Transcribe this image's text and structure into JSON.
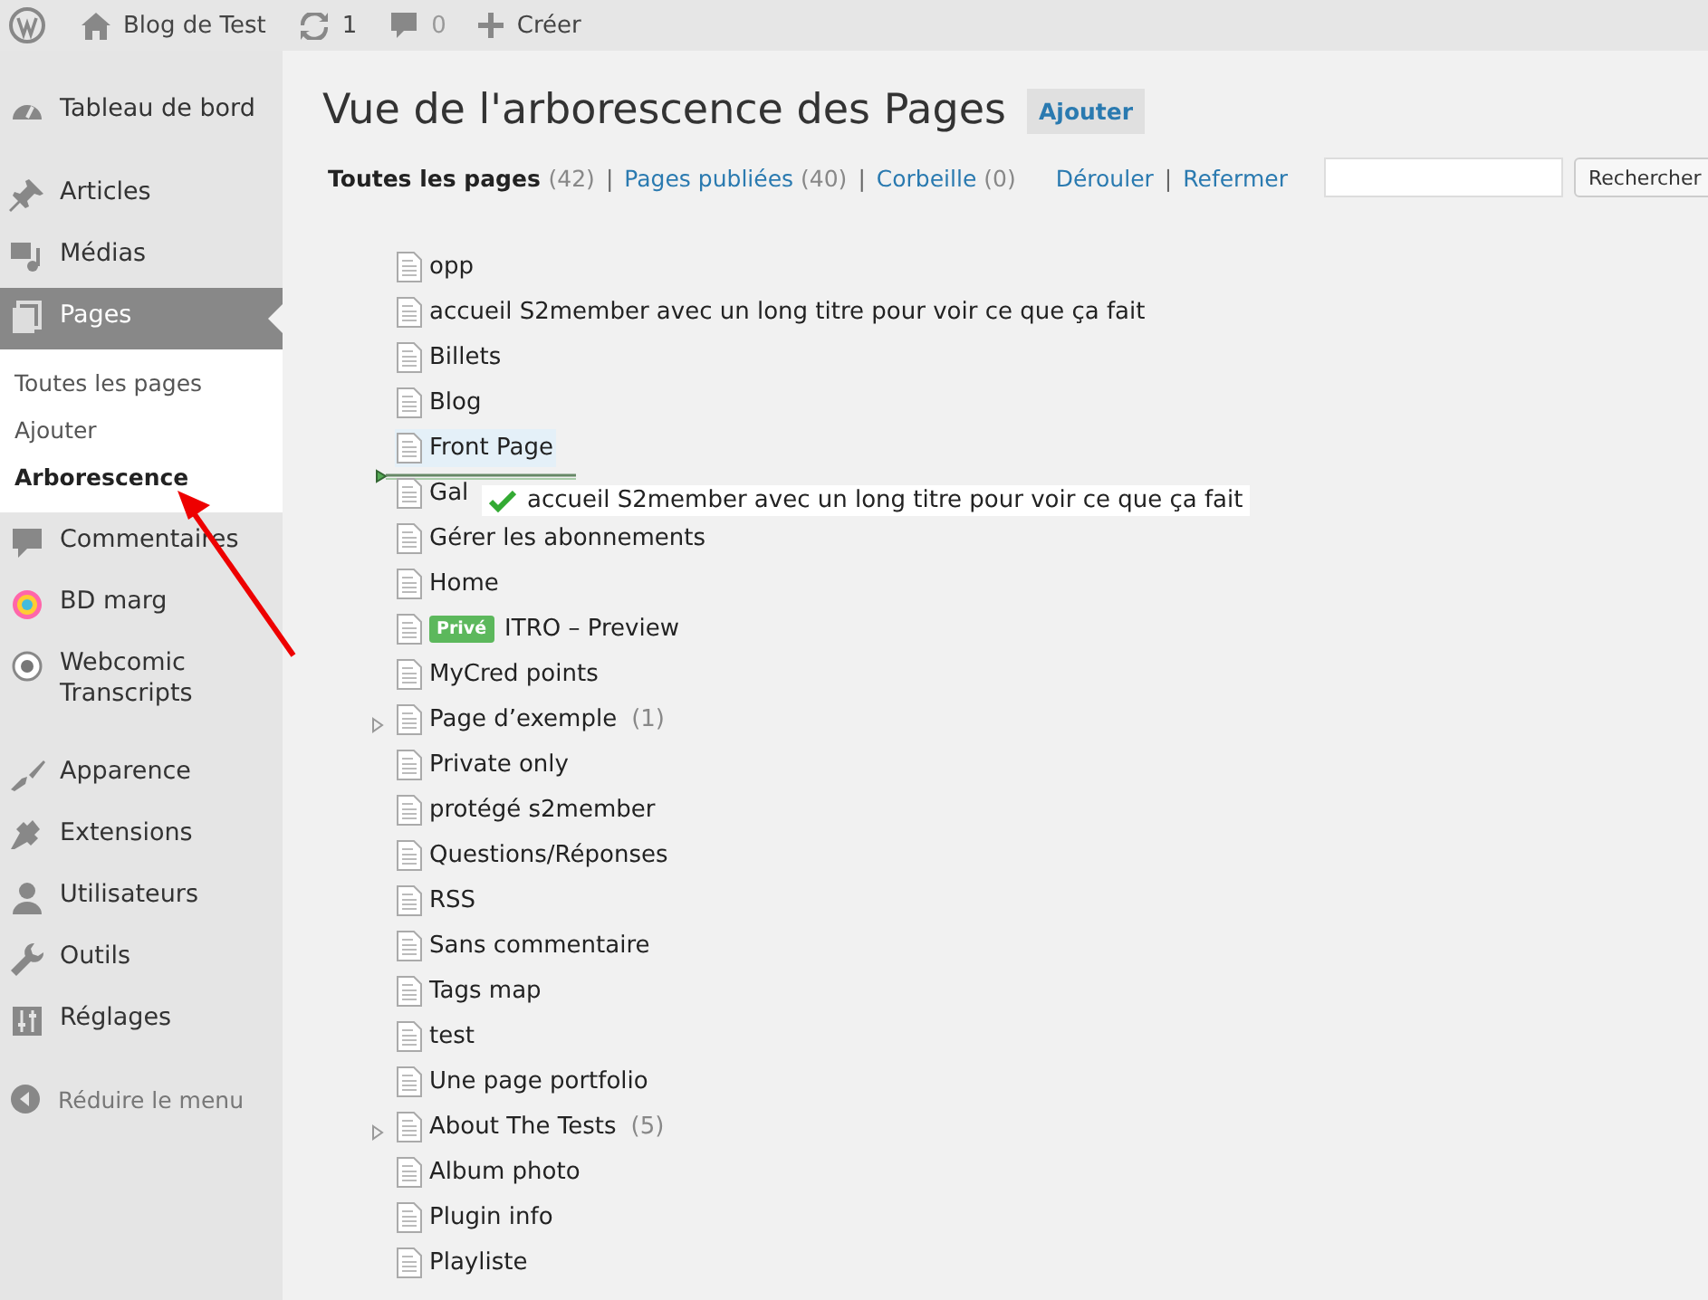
{
  "admin_bar": {
    "site": "Blog de Test",
    "updates": "1",
    "comments": "0",
    "new": "Créer"
  },
  "sidebar": {
    "groups": [
      [
        {
          "label": "Tableau de bord",
          "selected": false
        }
      ],
      [
        {
          "label": "Articles",
          "selected": false
        },
        {
          "label": "Médias",
          "selected": false
        },
        {
          "label": "Pages",
          "selected": true,
          "submenu": [
            {
              "label": "Toutes les pages",
              "selected": false
            },
            {
              "label": "Ajouter",
              "selected": false
            },
            {
              "label": "Arborescence",
              "selected": true
            }
          ]
        },
        {
          "label": "Commentaires",
          "selected": false
        },
        {
          "label": "BD marg",
          "selected": false
        },
        {
          "label": "Webcomic Transcripts",
          "selected": false
        }
      ],
      [
        {
          "label": "Apparence",
          "selected": false
        },
        {
          "label": "Extensions",
          "selected": false
        },
        {
          "label": "Utilisateurs",
          "selected": false
        },
        {
          "label": "Outils",
          "selected": false
        },
        {
          "label": "Réglages",
          "selected": false
        }
      ]
    ],
    "collapse": "Réduire le menu"
  },
  "heading": "Vue de l'arborescence des Pages",
  "add_button": "Ajouter",
  "filters": [
    {
      "label": "Toutes les pages",
      "count": "(42)",
      "selected": true
    },
    {
      "label": "Pages publiées",
      "count": "(40)",
      "selected": false,
      "separator": "|"
    },
    {
      "label": "Corbeille",
      "count": "(0)",
      "selected": false,
      "separator": "|"
    }
  ],
  "tree_actions": [
    {
      "label": "Dérouler"
    },
    {
      "label": "Refermer",
      "separator": "|"
    }
  ],
  "search_button": "Rechercher",
  "tree": [
    {
      "title": "opp",
      "expandable": false,
      "hovered": false
    },
    {
      "title": "accueil S2member avec un long titre pour voir ce que ça fait",
      "expandable": false,
      "hovered": false
    },
    {
      "title": "Billets",
      "expandable": false,
      "hovered": false
    },
    {
      "title": "Blog",
      "expandable": false,
      "hovered": false
    },
    {
      "title": "Front Page",
      "expandable": false,
      "hovered": true,
      "drop_after": true
    },
    {
      "title": "Gal",
      "expandable": false,
      "hovered": false,
      "dragging": "accueil S2member avec un long titre pour voir ce que ça fait"
    },
    {
      "title": "Gérer les abonnements",
      "expandable": false,
      "hovered": false
    },
    {
      "title": "Home",
      "expandable": false,
      "hovered": false
    },
    {
      "title": "ITRO – Preview",
      "expandable": false,
      "hovered": false,
      "badge": "Privé"
    },
    {
      "title": "MyCred points",
      "expandable": false,
      "hovered": false
    },
    {
      "title": "Page d’exemple",
      "expandable": true,
      "hovered": false,
      "count": "(1)"
    },
    {
      "title": "Private only",
      "expandable": false,
      "hovered": false
    },
    {
      "title": "protégé s2member",
      "expandable": false,
      "hovered": false
    },
    {
      "title": "Questions/Réponses",
      "expandable": false,
      "hovered": false
    },
    {
      "title": "RSS",
      "expandable": false,
      "hovered": false
    },
    {
      "title": "Sans commentaire",
      "expandable": false,
      "hovered": false
    },
    {
      "title": "Tags map",
      "expandable": false,
      "hovered": false
    },
    {
      "title": "test",
      "expandable": false,
      "hovered": false
    },
    {
      "title": "Une page portfolio",
      "expandable": false,
      "hovered": false
    },
    {
      "title": "About The Tests",
      "expandable": true,
      "hovered": false,
      "count": "(5)"
    },
    {
      "title": "Album photo",
      "expandable": false,
      "hovered": false
    },
    {
      "title": "Plugin info",
      "expandable": false,
      "hovered": false
    },
    {
      "title": "Playliste",
      "expandable": false,
      "hovered": false
    }
  ]
}
